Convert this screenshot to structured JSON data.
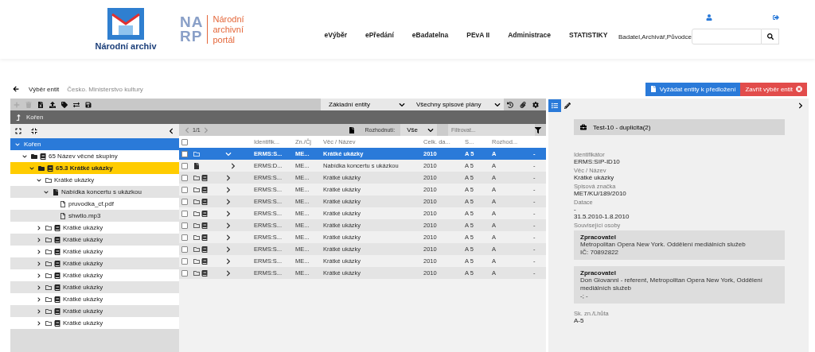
{
  "header": {
    "logo_text": "Národní archiv",
    "portal_letters": [
      "NA",
      "RP"
    ],
    "portal_text": [
      "Národní",
      "archivní",
      "portál"
    ],
    "nav": [
      "eVýběr",
      "ePředání",
      "eBadatelna",
      "PEvA II",
      "Administrace",
      "STATISTIKY"
    ],
    "user_roles": "Badatel,Archivář,Původce"
  },
  "breadcrumb": {
    "title": "Výběr entit",
    "subtitle": "Česko. Ministerstvo kultury"
  },
  "buttons": [
    {
      "label": "Vyžádat entity k předložení",
      "kind": "primary"
    },
    {
      "label": "Zavřít výběr entit",
      "kind": "danger"
    }
  ],
  "toolbar": {
    "actions": [
      {
        "kind": "add",
        "disabled": true
      },
      {
        "kind": "delete",
        "disabled": true
      },
      {
        "kind": "excel",
        "disabled": false
      },
      {
        "kind": "upload",
        "disabled": false
      },
      {
        "kind": "tag",
        "disabled": false
      },
      {
        "kind": "exchange",
        "disabled": false
      },
      {
        "kind": "save",
        "disabled": false
      }
    ],
    "selects": [
      "Základní entity",
      "Všechny spisové plány"
    ]
  },
  "path_bar": "Kořen",
  "tree": [
    {
      "label": "Kořen",
      "selected": true,
      "highlighted": false,
      "expanded": true,
      "children": [
        {
          "label": "65 Název věcné skupiny",
          "kind": "group",
          "selected": false,
          "highlighted": false,
          "expanded": true,
          "children": [
            {
              "label": "65.3 Krátké ukázky",
              "kind": "group",
              "selected": false,
              "highlighted": true,
              "expanded": true,
              "children": [
                {
                  "label": "Krátké ukázky",
                  "kind": "folder",
                  "selected": false,
                  "highlighted": false,
                  "expanded": true,
                  "children": [
                    {
                      "label": "Nabídka koncertu s ukázkou",
                      "kind": "document",
                      "selected": false,
                      "highlighted": false,
                      "expanded": true,
                      "children": [
                        {
                          "label": "pruvodka_cf.pdf",
                          "kind": "file",
                          "selected": false,
                          "highlighted": false
                        },
                        {
                          "label": "shwtlo.mp3",
                          "kind": "file",
                          "selected": false,
                          "highlighted": false
                        }
                      ]
                    }
                  ]
                },
                {
                  "label": "Krátké ukázky",
                  "kind": "folder_book",
                  "selected": false,
                  "highlighted": false,
                  "expanded": false
                },
                {
                  "label": "Krátké ukázky",
                  "kind": "folder_book",
                  "selected": false,
                  "highlighted": false,
                  "expanded": false
                },
                {
                  "label": "Krátké ukázky",
                  "kind": "folder_book",
                  "selected": false,
                  "highlighted": false,
                  "expanded": false
                },
                {
                  "label": "Krátké ukázky",
                  "kind": "folder_book",
                  "selected": false,
                  "highlighted": false,
                  "expanded": false
                },
                {
                  "label": "Krátké ukázky",
                  "kind": "folder_book",
                  "selected": false,
                  "highlighted": false,
                  "expanded": false
                },
                {
                  "label": "Krátké ukázky",
                  "kind": "folder_book",
                  "selected": false,
                  "highlighted": false,
                  "expanded": false
                },
                {
                  "label": "Krátké ukázky",
                  "kind": "folder_book",
                  "selected": false,
                  "highlighted": false,
                  "expanded": false
                },
                {
                  "label": "Krátké ukázky",
                  "kind": "folder_book",
                  "selected": false,
                  "highlighted": false,
                  "expanded": false
                },
                {
                  "label": "Krátké ukázky",
                  "kind": "folder_book",
                  "selected": false,
                  "highlighted": false,
                  "expanded": false
                }
              ]
            }
          ]
        }
      ]
    }
  ],
  "grid": {
    "select_all_checked": false,
    "pager": "1/1",
    "decision_label": "Rozhodnutí:",
    "decision_value": "Vše",
    "filter": {
      "placeholder": "Filtrovat..."
    },
    "columns": [
      "Identifik...",
      "Zn./Čj",
      "Věc / Název",
      "Celk. da...",
      "S...",
      "Rozhod..."
    ],
    "rows": [
      {
        "kind": "folder",
        "selected": true,
        "checked": false,
        "expanded": true,
        "cells": [
          "ERMS:S...",
          "ME...",
          "Krátké ukázky",
          "2010",
          "A 5",
          "A",
          "-"
        ]
      },
      {
        "kind": "document",
        "selected": false,
        "checked": false,
        "expanded": false,
        "cells": [
          "ERMS:D...",
          "ME...",
          "Nabídka koncertu s ukázkou",
          "2010",
          "A 5",
          "A",
          "-"
        ]
      },
      {
        "kind": "folder_book",
        "selected": false,
        "checked": false,
        "expanded": false,
        "cells": [
          "ERMS:S...",
          "ME...",
          "Krátké ukázky",
          "2010",
          "A 5",
          "A",
          "-"
        ]
      },
      {
        "kind": "folder_book",
        "selected": false,
        "checked": false,
        "expanded": false,
        "cells": [
          "ERMS:S...",
          "ME...",
          "Krátké ukázky",
          "2010",
          "A 5",
          "A",
          "-"
        ]
      },
      {
        "kind": "folder_book",
        "selected": false,
        "checked": false,
        "expanded": false,
        "cells": [
          "ERMS:S...",
          "ME...",
          "Krátké ukázky",
          "2010",
          "A 5",
          "A",
          "-"
        ]
      },
      {
        "kind": "folder_book",
        "selected": false,
        "checked": false,
        "expanded": false,
        "cells": [
          "ERMS:S...",
          "ME...",
          "Krátké ukázky",
          "2010",
          "A 5",
          "A",
          "-"
        ]
      },
      {
        "kind": "folder_book",
        "selected": false,
        "checked": false,
        "expanded": false,
        "cells": [
          "ERMS:S...",
          "ME...",
          "Krátké ukázky",
          "2010",
          "A 5",
          "A",
          "-"
        ]
      },
      {
        "kind": "folder_book",
        "selected": false,
        "checked": false,
        "expanded": false,
        "cells": [
          "ERMS:S...",
          "ME...",
          "Krátké ukázky",
          "2010",
          "A 5",
          "A",
          "-"
        ]
      },
      {
        "kind": "folder_book",
        "selected": false,
        "checked": false,
        "expanded": false,
        "cells": [
          "ERMS:S...",
          "ME...",
          "Krátké ukázky",
          "2010",
          "A 5",
          "A",
          "-"
        ]
      },
      {
        "kind": "folder_book",
        "selected": false,
        "checked": false,
        "expanded": false,
        "cells": [
          "ERMS:S...",
          "ME...",
          "Krátké ukázky",
          "2010",
          "A 5",
          "A",
          "-"
        ]
      },
      {
        "kind": "folder_book",
        "selected": false,
        "checked": false,
        "expanded": false,
        "cells": [
          "ERMS:S...",
          "ME...",
          "Krátké ukázky",
          "2010",
          "A 5",
          "A",
          "-"
        ]
      }
    ]
  },
  "detail": {
    "tabs": [
      {
        "kind": "list",
        "selected": true
      },
      {
        "kind": "edit",
        "selected": false
      }
    ],
    "title": "Test-10 - duplicita(2)",
    "fields": [
      {
        "label": "Identifikátor",
        "lines": [
          "ERMS:SIP-ID10"
        ]
      },
      {
        "label": "Věc / Název",
        "lines": [
          "Krátké ukázky"
        ]
      },
      {
        "label": "Spisová značka",
        "lines": [
          "MET/KU/189/2010"
        ]
      },
      {
        "label": "Datace",
        "lines": [
          "-",
          "31.5.2010-1.8.2010"
        ]
      }
    ],
    "persons_label": "Související osoby",
    "persons": [
      {
        "role": "Zpracovatel",
        "lines": [
          "Metropolitan Opera New York. Oddělení mediálních služeb",
          "IČ: 70892822"
        ]
      },
      {
        "role": "Zpracovatel",
        "lines": [
          "Don Giovanni - referent, Metropolitan Opera New York, Oddělení mediálních služeb",
          "-; -"
        ]
      }
    ],
    "footer_field": {
      "label": "Sk. zn./Lhůta",
      "lines": [
        "A-5"
      ]
    }
  }
}
